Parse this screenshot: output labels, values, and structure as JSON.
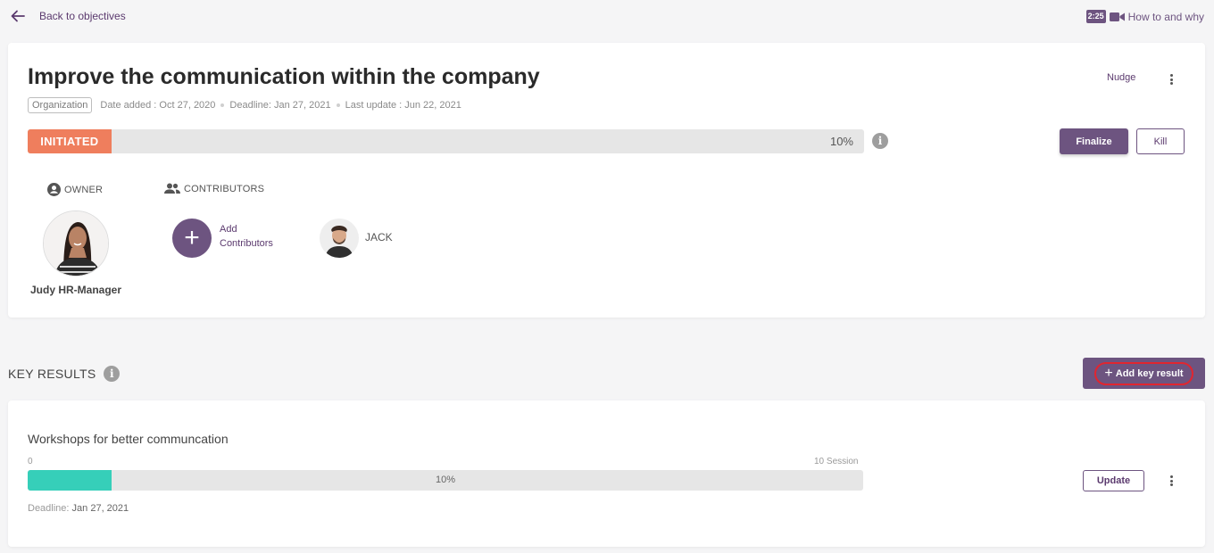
{
  "topbar": {
    "back_label": "Back to objectives",
    "video_duration": "2:25",
    "howto_label": "How to and why"
  },
  "objective": {
    "title": "Improve the communication within the company",
    "tag": "Organization",
    "date_added": "Date added : Oct 27, 2020",
    "deadline": "Deadline: Jan 27, 2021",
    "last_update": "Last update : Jun 22, 2021",
    "nudge_label": "Nudge",
    "status": "INITIATED",
    "status_color": "#ef7e5d",
    "progress_percent": 10,
    "progress_label": "10%",
    "finalize_label": "Finalize",
    "kill_label": "Kill"
  },
  "people": {
    "owner_heading": "OWNER",
    "owner_name": "Judy HR-Manager",
    "contributors_heading": "CONTRIBUTORS",
    "add_contributors_line1": "Add",
    "add_contributors_line2": "Contributors",
    "contributors": [
      {
        "name": "JACK"
      }
    ]
  },
  "key_results": {
    "heading": "KEY RESULTS",
    "add_label": "Add key result",
    "items": [
      {
        "name": "Workshops for better communcation",
        "min_label": "0",
        "max_label": "10 Session",
        "progress_percent": 10,
        "progress_label": "10%",
        "deadline_label": "Deadline:",
        "deadline_value": "Jan 27, 2021",
        "update_label": "Update"
      }
    ]
  },
  "colors": {
    "brand": "#6d5480",
    "kr_progress": "#36cfb9",
    "highlight_ring": "#e1252f"
  }
}
